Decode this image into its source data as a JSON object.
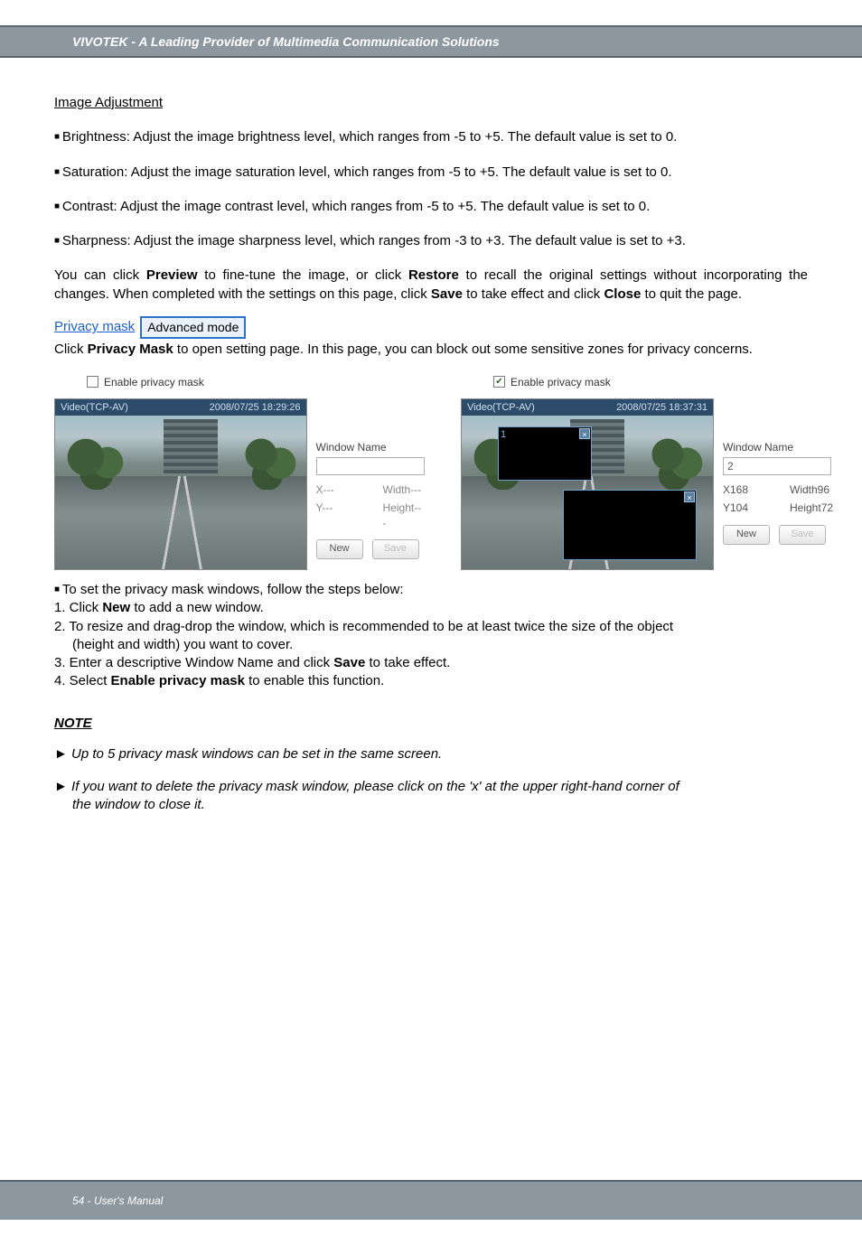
{
  "header": {
    "brand_line": "VIVOTEK - A Leading Provider of Multimedia Communication Solutions"
  },
  "section_image_adjustment": {
    "heading": "Image Adjustment",
    "bullets": [
      "Brightness: Adjust the image brightness level, which ranges from -5 to +5. The default value is set to 0.",
      "Saturation: Adjust the image saturation level, which ranges from -5 to +5. The default value is set to 0.",
      "Contrast: Adjust the image contrast level, which ranges from -5 to +5. The default value is set to 0.",
      "Sharpness: Adjust the image sharpness level, which ranges from -3 to +3. The default value is set to +3."
    ],
    "paragraph": "You can click Preview to fine-tune the image, or click Restore to recall the original settings without incorporating the changes. When completed with the settings on this page, click Save to take effect and click Close to quit the page.",
    "bold_words": [
      "Preview",
      "Restore",
      "Save",
      "Close"
    ]
  },
  "section_privacy_mask": {
    "link_text": "Privacy mask",
    "badge": "Advanced mode",
    "intro": "Click Privacy Mask to open setting page. In this page, you can block out some sensitive zones for privacy concerns.",
    "bold_words": [
      "Privacy Mask"
    ]
  },
  "screenshots": {
    "left": {
      "checkbox_checked": false,
      "checkbox_label": "Enable privacy mask",
      "title_left": "Video(TCP-AV)",
      "title_right": "2008/07/25 18:29:26",
      "window_name_label": "Window Name",
      "window_name_value": "",
      "x_label": "X---",
      "width_label": "Width---",
      "y_label": "Y---",
      "height_label": "Height---",
      "btn_new": "New",
      "btn_save": "Save"
    },
    "right": {
      "checkbox_checked": true,
      "checkbox_label": "Enable privacy mask",
      "title_left": "Video(TCP-AV)",
      "title_right": "2008/07/25 18:37:31",
      "window_name_label": "Window Name",
      "window_name_value": "2",
      "x_label": "X168",
      "width_label": "Width96",
      "y_label": "Y104",
      "height_label": "Height72",
      "btn_new": "New",
      "btn_save": "Save",
      "mask1_num": "1",
      "mask2_num": ""
    }
  },
  "steps": {
    "lead": "To set the privacy mask windows, follow the steps below:",
    "items": [
      "1. Click New to add a new window.",
      "2. To resize and drag-drop the window, which is recommended to be at least twice the size of the object",
      "(height and width) you want to cover.",
      "3. Enter a descriptive Window Name and click Save to take effect.",
      "4. Select Enable privacy mask to enable this function."
    ]
  },
  "notes": {
    "heading": "NOTE",
    "items": [
      "Up to 5 privacy mask windows can be set in the same screen.",
      "If you want to delete the privacy mask window, please click on the 'x' at the upper right-hand corner of",
      "the window to close it."
    ]
  },
  "footer": {
    "text": "54 - User's Manual"
  }
}
